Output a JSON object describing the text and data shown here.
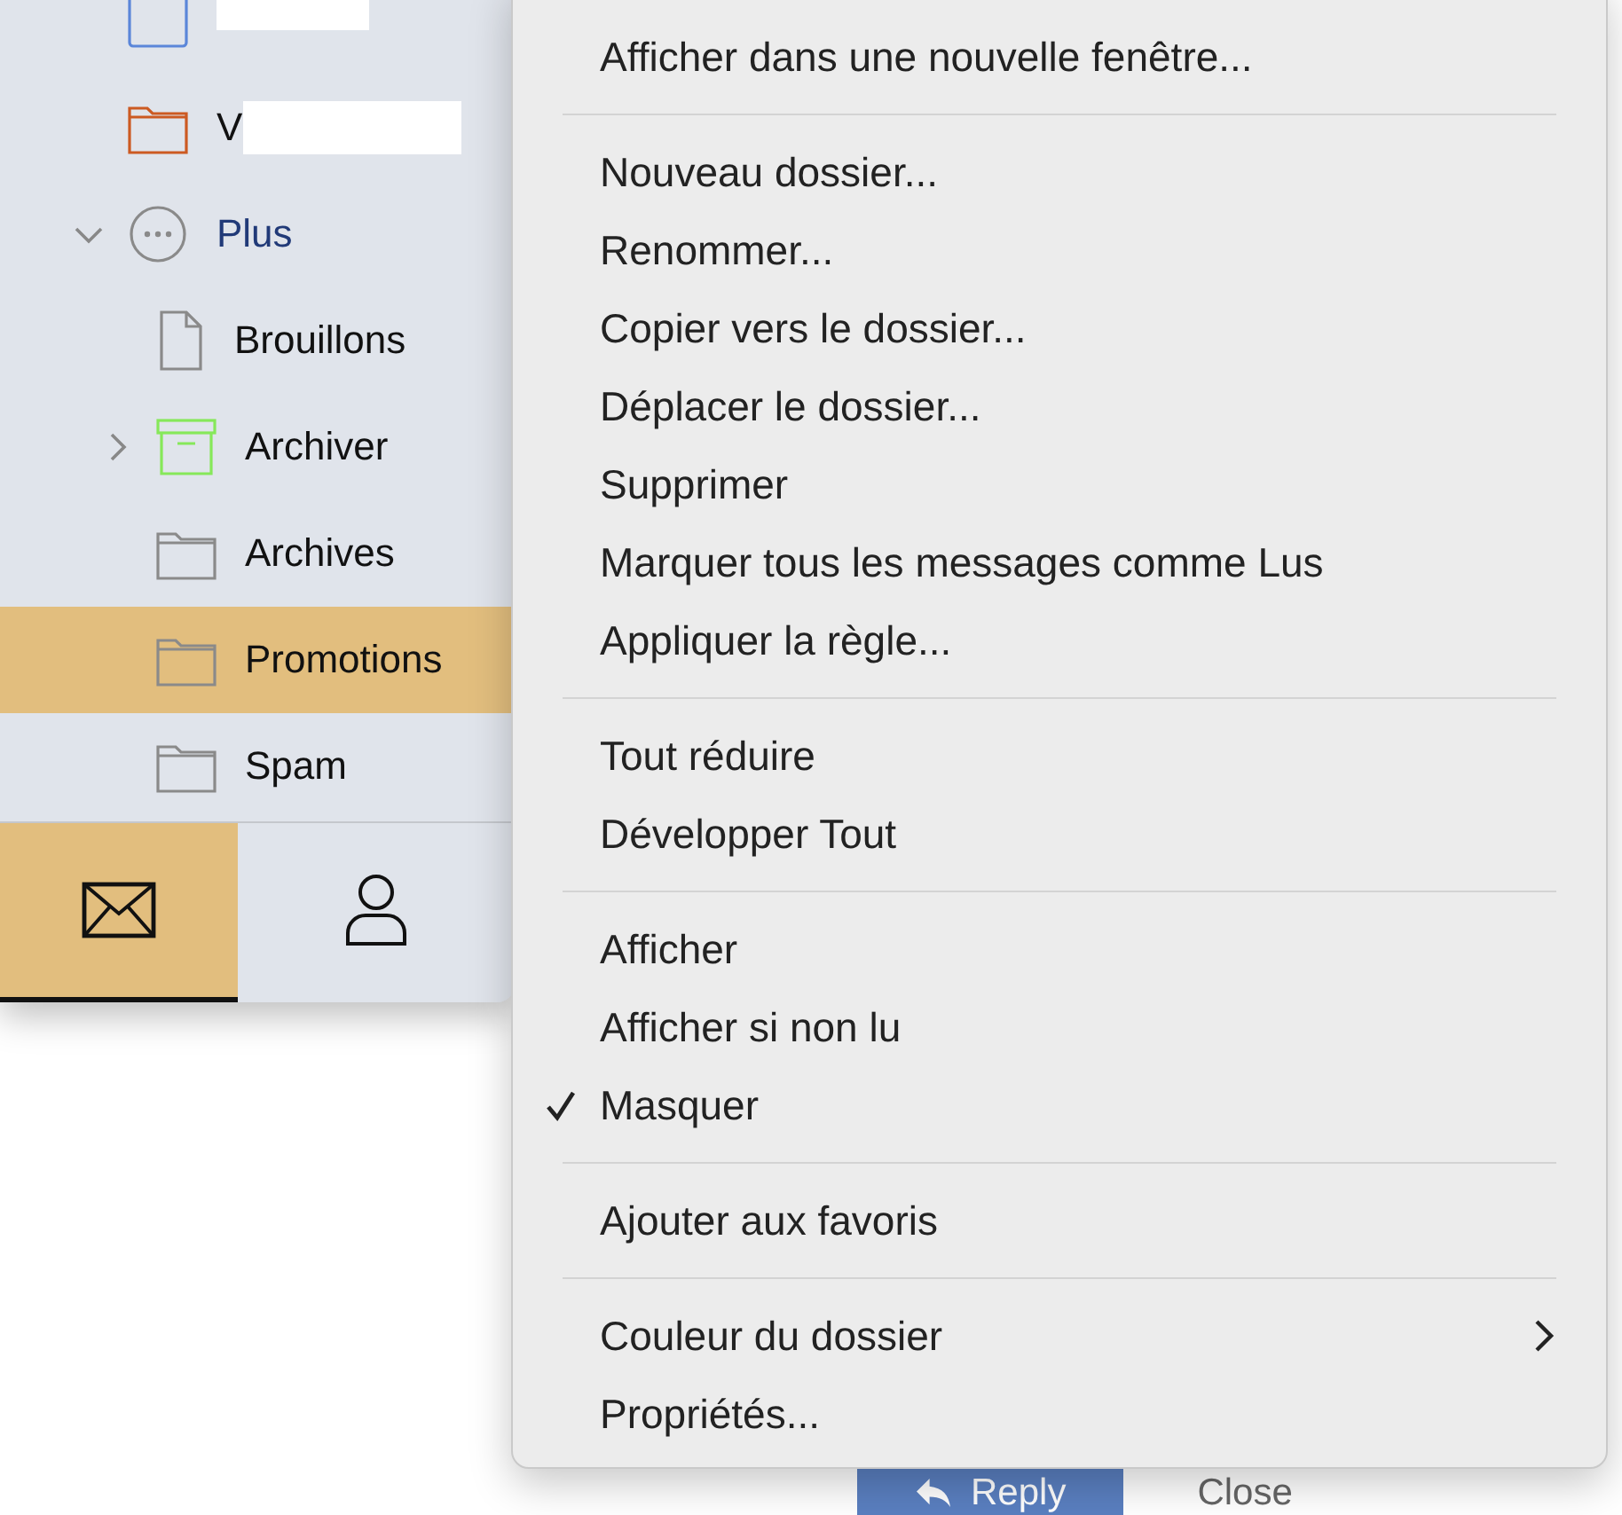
{
  "sidebar": {
    "folders": [
      {
        "kind": "folder-square",
        "color": "#5b86d9",
        "redacted": true,
        "selected": false
      },
      {
        "label": "V",
        "kind": "folder",
        "color": "#cc5a22",
        "redacted": true,
        "selected": false
      },
      {
        "label": "Plus",
        "kind": "more",
        "color": "#8a8a8a",
        "expanded": true,
        "selected": false,
        "children": [
          {
            "label": "Brouillons",
            "kind": "page",
            "color": "#8a8a8a",
            "selected": false
          },
          {
            "label": "Archiver",
            "kind": "archive",
            "color": "#86e85a",
            "expanded": false,
            "selected": false
          },
          {
            "label": "Archives",
            "kind": "folder",
            "color": "#8a8a8a",
            "selected": false
          },
          {
            "label": "Promotions",
            "kind": "folder",
            "color": "#8a8a8a",
            "selected": true
          },
          {
            "label": "Spam",
            "kind": "folder",
            "color": "#8a8a8a",
            "selected": false
          }
        ]
      }
    ]
  },
  "bottom_tabs": [
    {
      "kind": "mail",
      "selected": true
    },
    {
      "kind": "person",
      "selected": false
    }
  ],
  "buttons": [
    {
      "label": "Reply",
      "kind": "primary"
    },
    {
      "label": "Close",
      "kind": "plain"
    }
  ],
  "context_menu": {
    "sections": [
      [
        {
          "label": "Afficher dans une nouvelle fenêtre...",
          "kind": "action",
          "checked": false
        }
      ],
      [
        {
          "label": "Nouveau dossier...",
          "kind": "action",
          "checked": false
        },
        {
          "label": "Renommer...",
          "kind": "action",
          "checked": false
        },
        {
          "label": "Copier vers le dossier...",
          "kind": "action",
          "checked": false
        },
        {
          "label": "Déplacer le dossier...",
          "kind": "action",
          "checked": false
        },
        {
          "label": "Supprimer",
          "kind": "action",
          "checked": false
        },
        {
          "label": "Marquer tous les messages comme Lus",
          "kind": "action",
          "checked": false
        },
        {
          "label": "Appliquer la règle...",
          "kind": "action",
          "checked": false
        }
      ],
      [
        {
          "label": "Tout réduire",
          "kind": "action",
          "checked": false
        },
        {
          "label": "Développer Tout",
          "kind": "action",
          "checked": false
        }
      ],
      [
        {
          "label": "Afficher",
          "kind": "action",
          "checked": false
        },
        {
          "label": "Afficher si non lu",
          "kind": "action",
          "checked": false
        },
        {
          "label": "Masquer",
          "kind": "action",
          "checked": true
        }
      ],
      [
        {
          "label": "Ajouter aux favoris",
          "kind": "action",
          "checked": false
        }
      ],
      [
        {
          "label": "Couleur du dossier",
          "kind": "submenu",
          "checked": false
        },
        {
          "label": "Propriétés...",
          "kind": "action",
          "checked": false
        }
      ]
    ]
  }
}
